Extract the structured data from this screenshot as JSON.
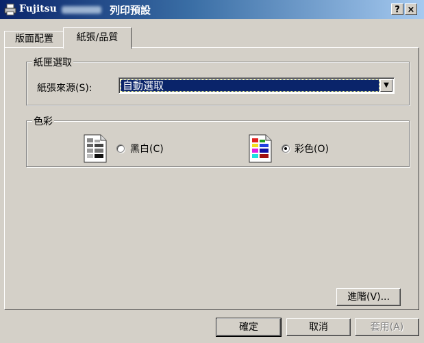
{
  "window": {
    "app_name": "Fujitsu",
    "title": "列印預設",
    "help_button": "?",
    "close_button": "×"
  },
  "tabs": [
    {
      "label": "版面配置",
      "active": false
    },
    {
      "label": "紙張/品質",
      "active": true
    }
  ],
  "paper_group": {
    "legend": "紙匣選取",
    "source_label": "紙張來源(S):",
    "source_value": "自動選取"
  },
  "color_group": {
    "legend": "色彩",
    "options": [
      {
        "label": "黑白(C)",
        "selected": false,
        "icon": "grayscale-page-icon"
      },
      {
        "label": "彩色(O)",
        "selected": true,
        "icon": "color-page-icon"
      }
    ]
  },
  "advanced_button": "進階(V)...",
  "footer": {
    "ok": "確定",
    "cancel": "取消",
    "apply": "套用(A)",
    "apply_enabled": false
  },
  "colors": {
    "selection": "#0a246a",
    "face": "#d4d0c8"
  }
}
